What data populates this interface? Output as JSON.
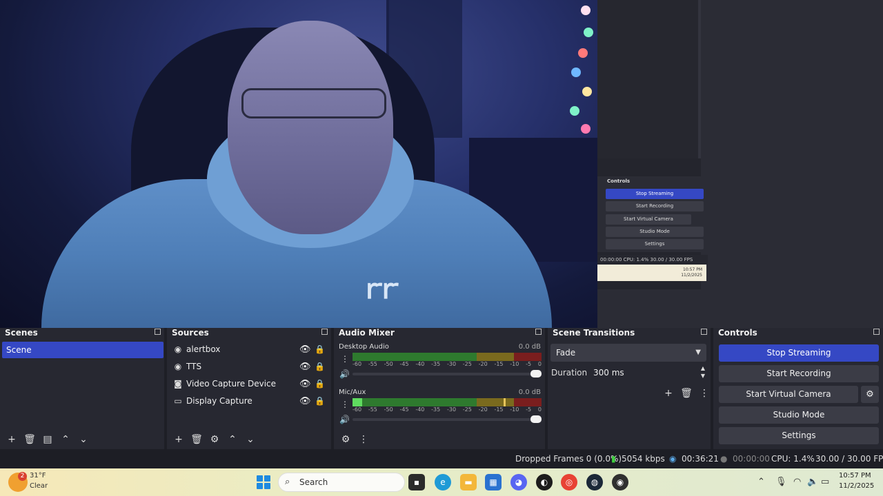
{
  "preview": {
    "mini_controls": {
      "title": "Controls",
      "buttons": [
        "Stop Streaming",
        "Start Recording",
        "Start Virtual Camera",
        "Studio Mode",
        "Settings"
      ],
      "status": "00:00:00   CPU: 1.4%   30.00 / 30.00 FPS",
      "clock": "10:57 PM",
      "date": "11/2/2025"
    },
    "logo_text": "ꭈꭈ"
  },
  "scenes": {
    "title": "Scenes",
    "items": [
      "Scene"
    ]
  },
  "sources": {
    "title": "Sources",
    "items": [
      {
        "label": "alertbox",
        "icon": "browser-icon"
      },
      {
        "label": "TTS",
        "icon": "browser-icon"
      },
      {
        "label": "Video Capture Device",
        "icon": "camera-icon"
      },
      {
        "label": "Display Capture",
        "icon": "monitor-icon"
      }
    ]
  },
  "mixer": {
    "title": "Audio Mixer",
    "ticks": [
      "-60",
      "-55",
      "-50",
      "-45",
      "-40",
      "-35",
      "-30",
      "-25",
      "-20",
      "-15",
      "-10",
      "-5",
      "0"
    ],
    "channels": [
      {
        "name": "Desktop Audio",
        "db": "0.0 dB",
        "level": 0,
        "peak": 0,
        "volume": 1.0
      },
      {
        "name": "Mic/Aux",
        "db": "0.0 dB",
        "level": 0.05,
        "peak": 0.8,
        "volume": 1.0
      }
    ]
  },
  "transitions": {
    "title": "Scene Transitions",
    "selected": "Fade",
    "duration_label": "Duration",
    "duration_value": "300 ms"
  },
  "controls": {
    "title": "Controls",
    "stop_streaming": "Stop Streaming",
    "start_recording": "Start Recording",
    "start_virtual_camera": "Start Virtual Camera",
    "studio_mode": "Studio Mode",
    "settings": "Settings"
  },
  "status": {
    "dropped_frames": "Dropped Frames 0 (0.0%)",
    "bitrate": "5054 kbps",
    "stream_time": "00:36:21",
    "record_time": "00:00:00",
    "cpu": "CPU: 1.4%",
    "fps": "30.00 / 30.00 FPS"
  },
  "taskbar": {
    "weather_badge": "2",
    "temperature": "31°F",
    "condition": "Clear",
    "search_label": "Search",
    "time": "10:57 PM",
    "date": "11/2/2025",
    "apps": [
      "file-explorer-icon",
      "edge-icon",
      "folder-icon",
      "store-icon",
      "discord-icon",
      "github-icon",
      "chrome-icon",
      "steam-icon",
      "obs-icon"
    ]
  },
  "colors": {
    "accent": "#3548c4",
    "dock_bg": "#272831",
    "meter_green": "#2e7a2e",
    "meter_yellow": "#7a6a1e",
    "meter_red": "#7a1e1e"
  }
}
